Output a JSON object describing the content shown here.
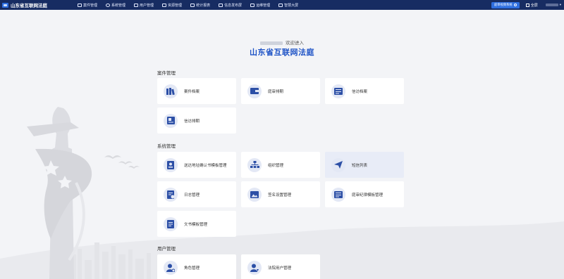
{
  "header": {
    "title": "山东省互联网法庭",
    "nav": [
      {
        "label": "案件管理",
        "icon": "folder-icon"
      },
      {
        "label": "系统管理",
        "icon": "settings-icon"
      },
      {
        "label": "用户管理",
        "icon": "user-icon"
      },
      {
        "label": "资源管理",
        "icon": "database-icon"
      },
      {
        "label": "统计报表",
        "icon": "chart-icon"
      },
      {
        "label": "信息发布屏",
        "icon": "monitor-icon"
      },
      {
        "label": "运维管理",
        "icon": "folder-icon"
      },
      {
        "label": "智慧大屏",
        "icon": "screen-icon"
      }
    ],
    "switch_button": "庭审视频系统",
    "fullscreen": "全屏",
    "username_caret": "▾"
  },
  "welcome": {
    "prefix_hidden": true,
    "text": "欢迎进入"
  },
  "main_title": "山东省互联网法庭",
  "sections": [
    {
      "title": "案件管理",
      "items": [
        "案件档案",
        "庭审排期",
        "信访档案",
        "信访排期"
      ]
    },
    {
      "title": "系统管理",
      "items": [
        "送达地址确认书模板管理",
        "组织管理",
        "短信列表",
        "日志管理",
        "签名设置管理",
        "庭审纪律模板管理",
        "文书模板管理"
      ]
    },
    {
      "title": "用户管理",
      "items": [
        "角色管理",
        "法院用户管理"
      ]
    }
  ],
  "colors": {
    "nav_bg": "#172c62",
    "accent": "#1d52c6",
    "icon": "#2c4fa6",
    "icon_bg": "#e3e8f5"
  }
}
